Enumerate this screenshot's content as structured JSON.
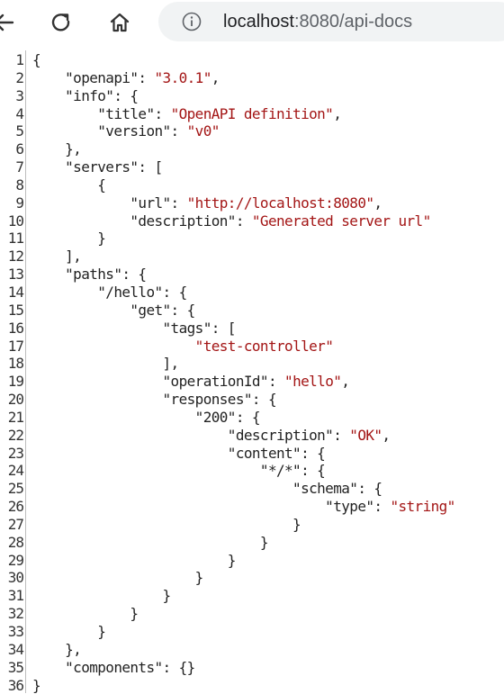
{
  "browser": {
    "url_host": "localhost",
    "url_rest": ":8080/api-docs"
  },
  "line_numbers": [
    "1",
    "2",
    "3",
    "4",
    "5",
    "6",
    "7",
    "8",
    "9",
    "10",
    "11",
    "12",
    "13",
    "14",
    "15",
    "16",
    "17",
    "18",
    "19",
    "20",
    "21",
    "22",
    "23",
    "24",
    "25",
    "26",
    "27",
    "28",
    "29",
    "30",
    "31",
    "32",
    "33",
    "34",
    "35",
    "36"
  ],
  "code_lines": [
    [
      "{"
    ],
    [
      "    \"openapi\": ",
      "\"3.0.1\"",
      ","
    ],
    [
      "    \"info\": {"
    ],
    [
      "        \"title\": ",
      "\"OpenAPI definition\"",
      ","
    ],
    [
      "        \"version\": ",
      "\"v0\""
    ],
    [
      "    },"
    ],
    [
      "    \"servers\": ["
    ],
    [
      "        {"
    ],
    [
      "            \"url\": ",
      "\"http://localhost:8080\"",
      ","
    ],
    [
      "            \"description\": ",
      "\"Generated server url\""
    ],
    [
      "        }"
    ],
    [
      "    ],"
    ],
    [
      "    \"paths\": {"
    ],
    [
      "        \"/hello\": {"
    ],
    [
      "            \"get\": {"
    ],
    [
      "                \"tags\": ["
    ],
    [
      "                    ",
      "\"test-controller\""
    ],
    [
      "                ],"
    ],
    [
      "                \"operationId\": ",
      "\"hello\"",
      ","
    ],
    [
      "                \"responses\": {"
    ],
    [
      "                    \"200\": {"
    ],
    [
      "                        \"description\": ",
      "\"OK\"",
      ","
    ],
    [
      "                        \"content\": {"
    ],
    [
      "                            \"*/*\": {"
    ],
    [
      "                                \"schema\": {"
    ],
    [
      "                                    \"type\": ",
      "\"string\""
    ],
    [
      "                                }"
    ],
    [
      "                            }"
    ],
    [
      "                        }"
    ],
    [
      "                    }"
    ],
    [
      "                }"
    ],
    [
      "            }"
    ],
    [
      "        }"
    ],
    [
      "    },"
    ],
    [
      "    \"components\": {}"
    ],
    [
      "}"
    ]
  ]
}
